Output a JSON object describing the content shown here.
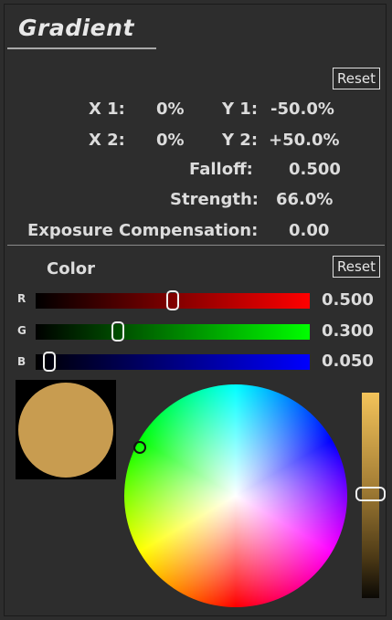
{
  "title": "Gradient",
  "reset_label": "Reset",
  "position": {
    "x1": {
      "label": "X 1:",
      "value": "0%"
    },
    "y1": {
      "label": "Y 1:",
      "value": "-50.0%"
    },
    "x2": {
      "label": "X 2:",
      "value": "0%"
    },
    "y2": {
      "label": "Y 2:",
      "value": "+50.0%"
    }
  },
  "falloff": {
    "label": "Falloff:",
    "value": "0.500"
  },
  "strength": {
    "label": "Strength:",
    "value": "66.0%"
  },
  "exposure": {
    "label": "Exposure Compensation:",
    "value": "0.00"
  },
  "color": {
    "label": "Color",
    "reset_label": "Reset",
    "channels": [
      {
        "name": "R",
        "value": "0.500",
        "level": 0.5,
        "color": "#ff0000"
      },
      {
        "name": "G",
        "value": "0.300",
        "level": 0.3,
        "color": "#00ff00"
      },
      {
        "name": "B",
        "value": "0.050",
        "level": 0.05,
        "color": "#0000ff"
      }
    ],
    "swatch_color": "#c89c50",
    "brightness_level": 0.5
  }
}
